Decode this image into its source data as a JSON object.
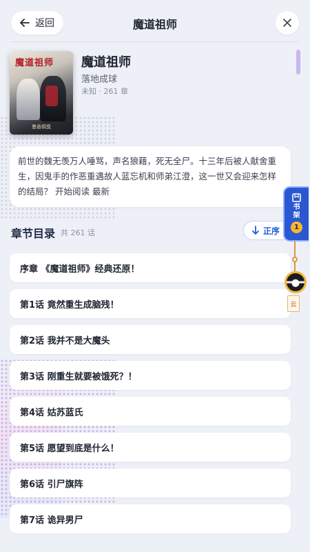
{
  "header": {
    "back_label": "返回",
    "title": "魔道祖师"
  },
  "book": {
    "cover_title": "魔道祖师",
    "cover_subtitle": "墨香铜臭",
    "name": "魔道祖师",
    "author": "落地成球",
    "meta": "未知 · 261 章",
    "description": "前世的魏无羡万人唾骂，声名狼藉，死无全尸。十三年后被人献舍重生，因鬼手的作恶重遇故人蓝忘机和师弟江澄，这一世又会迎来怎样的结局？ 开始阅读 最新"
  },
  "catalog": {
    "title": "章节目录",
    "count": "共 261 话",
    "sort_label": "正序",
    "chapters": [
      "序章 《魔道祖师》经典还原！",
      "第1话 竟然重生成脑残！",
      "第2话 我并不是大魔头",
      "第3话 刚重生就要被饿死？！",
      "第4话 姑苏蓝氏",
      "第5话 愿望到底是什么！",
      "第6话 引尸旗阵",
      "第7话 诡异男尸"
    ]
  },
  "shelf": {
    "label": "书架",
    "badge": "1",
    "tassel_text": "云"
  },
  "colors": {
    "accent": "#2a58d3",
    "sort_text": "#1e5fd6",
    "badge": "#f6b82d"
  }
}
